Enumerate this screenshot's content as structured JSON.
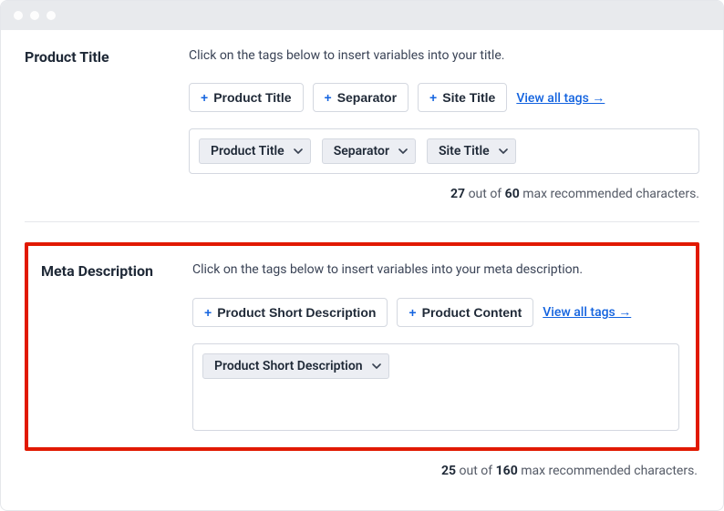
{
  "sections": {
    "title": {
      "label": "Product Title",
      "instruction": "Click on the tags below to insert variables into your title.",
      "tags": [
        "Product Title",
        "Separator",
        "Site Title"
      ],
      "view_all": "View all tags →",
      "chips": [
        "Product Title",
        "Separator",
        "Site Title"
      ],
      "counter": {
        "current": "27",
        "sep": " out of ",
        "max": "60",
        "suffix": " max recommended characters."
      }
    },
    "meta": {
      "label": "Meta Description",
      "instruction": "Click on the tags below to insert variables into your meta description.",
      "tags": [
        "Product Short Description",
        "Product Content"
      ],
      "view_all": "View all tags →",
      "chips": [
        "Product Short Description"
      ],
      "counter": {
        "current": "25",
        "sep": " out of ",
        "max": "160",
        "suffix": " max recommended characters."
      }
    }
  },
  "plus_sign": "+"
}
